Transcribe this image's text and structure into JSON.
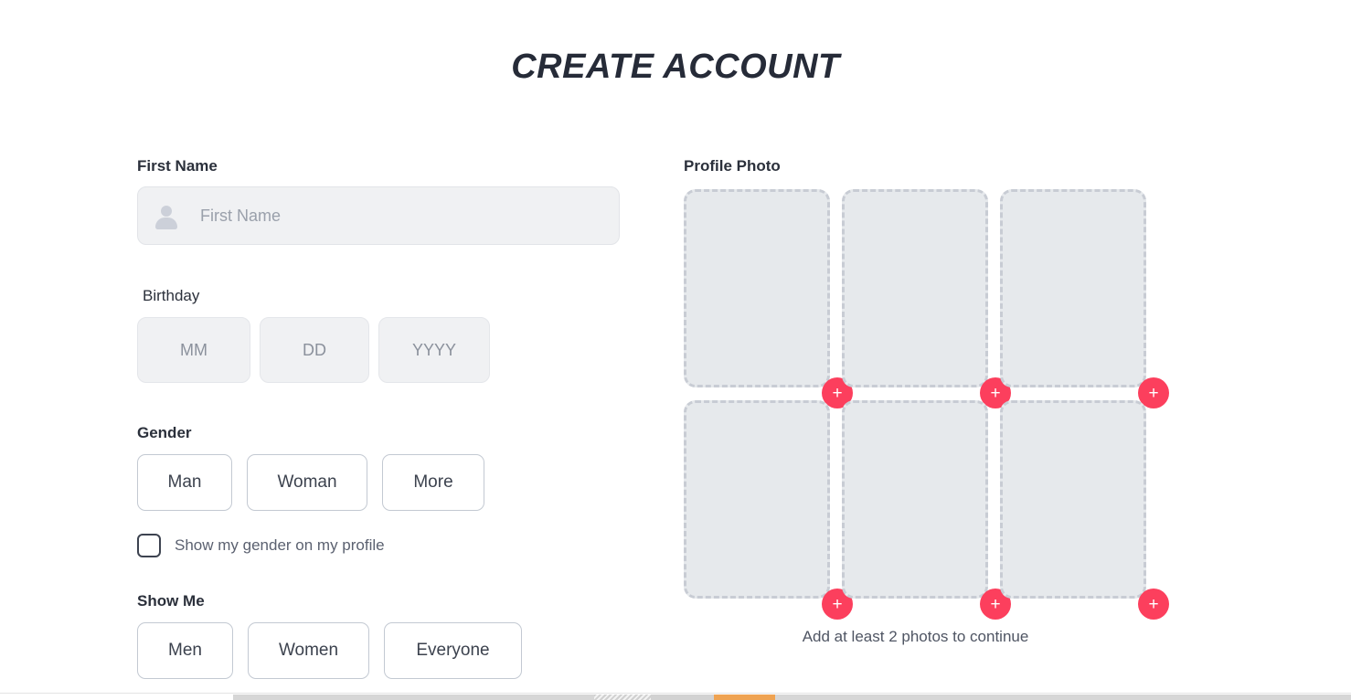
{
  "page": {
    "title": "CREATE ACCOUNT"
  },
  "form": {
    "first_name": {
      "label": "First Name",
      "placeholder": "First Name",
      "value": "",
      "icon": "person-icon"
    },
    "birthday": {
      "label": "Birthday",
      "month_placeholder": "MM",
      "day_placeholder": "DD",
      "year_placeholder": "YYYY",
      "month_value": "",
      "day_value": "",
      "year_value": ""
    },
    "gender": {
      "label": "Gender",
      "options": [
        "Man",
        "Woman",
        "More"
      ],
      "selected": "",
      "show_on_profile_label": "Show my gender on my profile",
      "show_on_profile_checked": false
    },
    "show_me": {
      "label": "Show Me",
      "options": [
        "Men",
        "Women",
        "Everyone"
      ],
      "selected": ""
    }
  },
  "photos": {
    "label": "Profile Photo",
    "hint": "Add at least 2 photos to continue",
    "add_icon": "plus-icon",
    "slots": [
      {
        "index": 1,
        "filled": false
      },
      {
        "index": 2,
        "filled": false
      },
      {
        "index": 3,
        "filled": false
      },
      {
        "index": 4,
        "filled": false
      },
      {
        "index": 5,
        "filled": false
      },
      {
        "index": 6,
        "filled": false
      }
    ],
    "add_symbol": "+"
  },
  "colors": {
    "accent_red": "#fc3f5d",
    "title_dark": "#262b38",
    "field_bg": "#f0f1f3",
    "slot_bg": "#e6e9ec",
    "slot_border": "#c8ccd4",
    "chip_border": "#c3c9d2",
    "placeholder_text": "#9aa0ab"
  }
}
